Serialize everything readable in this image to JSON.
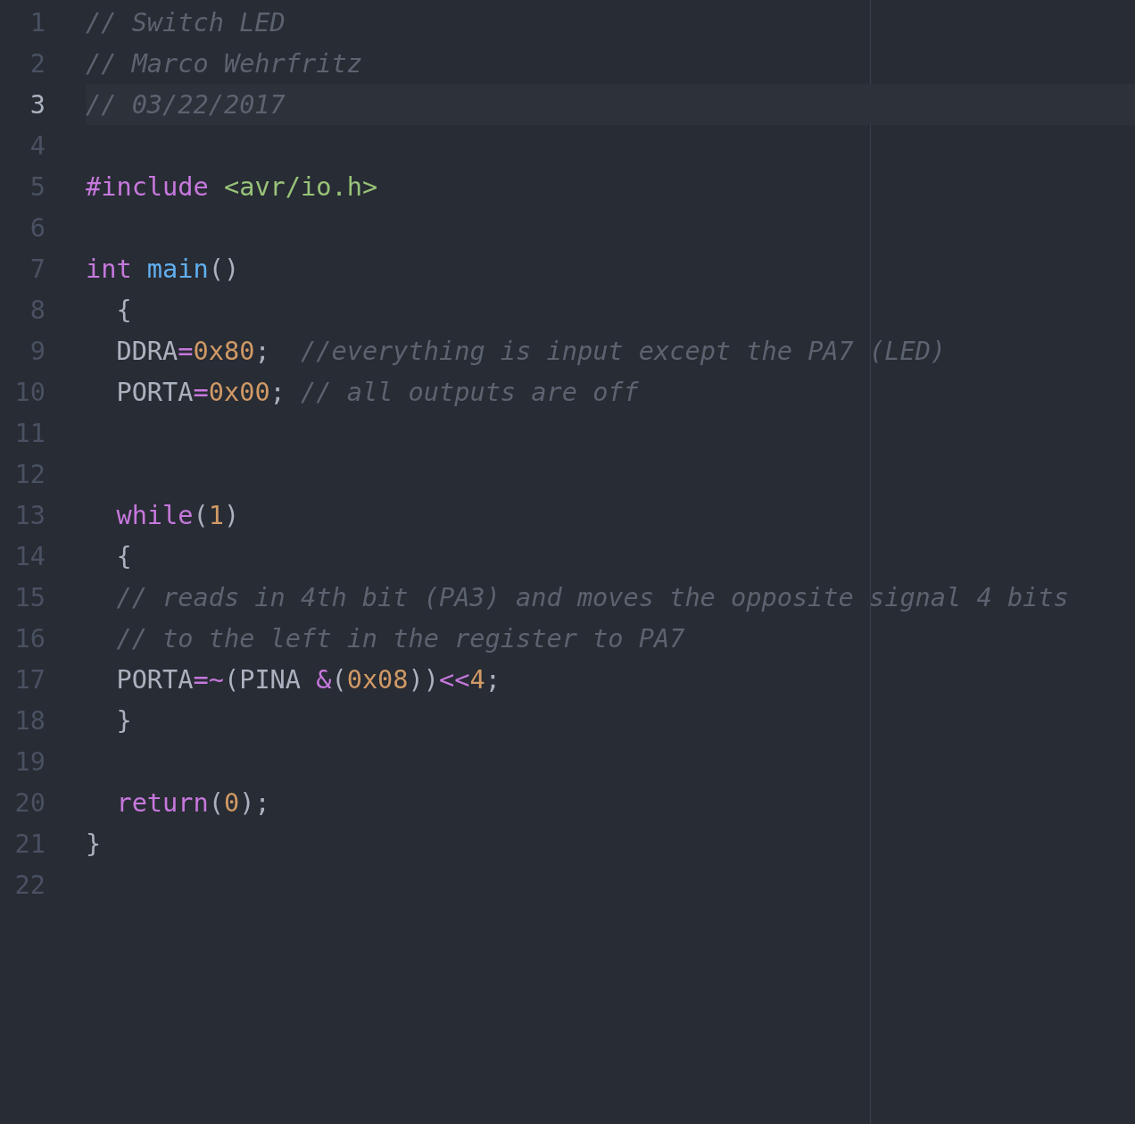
{
  "editor": {
    "lines": [
      {
        "number": "1",
        "selected": false,
        "tokens": [
          {
            "kind": "comment",
            "text": "// Switch LED"
          }
        ]
      },
      {
        "number": "2",
        "selected": false,
        "tokens": [
          {
            "kind": "comment",
            "text": "// Marco Wehrfritz"
          }
        ]
      },
      {
        "number": "3",
        "selected": true,
        "tokens": [
          {
            "kind": "comment",
            "text": "// 03/22/2017"
          }
        ]
      },
      {
        "number": "4",
        "selected": false
      },
      {
        "number": "5",
        "selected": false,
        "tokens": [
          {
            "kind": "keyword",
            "text": "#include"
          },
          {
            "kind": "string",
            "text": " <avr/io.h>"
          }
        ]
      },
      {
        "number": "6",
        "selected": false
      },
      {
        "number": "7",
        "selected": false,
        "tokens": [
          {
            "kind": "keyword",
            "text": "int"
          },
          {
            "kind": "function",
            "text": " main"
          },
          {
            "kind": "plain",
            "text": "()"
          }
        ]
      },
      {
        "number": "8",
        "selected": false,
        "tokens": [
          {
            "kind": "plain",
            "text": "  {"
          }
        ]
      },
      {
        "number": "9",
        "selected": false,
        "tokens": [
          {
            "kind": "plain",
            "text": "  DDRA"
          },
          {
            "kind": "operator",
            "text": "="
          },
          {
            "kind": "number",
            "text": "0x80"
          },
          {
            "kind": "plain",
            "text": ";  "
          },
          {
            "kind": "comment",
            "text": "//everything is input except the PA7 (LED)"
          }
        ]
      },
      {
        "number": "10",
        "selected": false,
        "tokens": [
          {
            "kind": "plain",
            "text": "  PORTA"
          },
          {
            "kind": "operator",
            "text": "="
          },
          {
            "kind": "number",
            "text": "0x00"
          },
          {
            "kind": "plain",
            "text": "; "
          },
          {
            "kind": "comment",
            "text": "// all outputs are off"
          }
        ]
      },
      {
        "number": "11",
        "selected": false
      },
      {
        "number": "12",
        "selected": false
      },
      {
        "number": "13",
        "selected": false,
        "tokens": [
          {
            "kind": "keyword",
            "text": "  while"
          },
          {
            "kind": "plain",
            "text": "("
          },
          {
            "kind": "number",
            "text": "1"
          },
          {
            "kind": "plain",
            "text": ")"
          }
        ]
      },
      {
        "number": "14",
        "selected": false,
        "tokens": [
          {
            "kind": "plain",
            "text": "  {"
          }
        ]
      },
      {
        "number": "15",
        "selected": false,
        "tokens": [
          {
            "kind": "comment",
            "text": "  // reads in 4th bit (PA3) and moves the opposite signal 4 bits"
          }
        ]
      },
      {
        "number": "16",
        "selected": false,
        "tokens": [
          {
            "kind": "comment",
            "text": "  // to the left in the register to PA7"
          }
        ]
      },
      {
        "number": "17",
        "selected": false,
        "tokens": [
          {
            "kind": "plain",
            "text": "  PORTA"
          },
          {
            "kind": "operator",
            "text": "=~"
          },
          {
            "kind": "plain",
            "text": "(PINA "
          },
          {
            "kind": "operator",
            "text": "&"
          },
          {
            "kind": "plain",
            "text": "("
          },
          {
            "kind": "number",
            "text": "0x08"
          },
          {
            "kind": "plain",
            "text": "))"
          },
          {
            "kind": "operator",
            "text": "<<"
          },
          {
            "kind": "number",
            "text": "4"
          },
          {
            "kind": "plain",
            "text": ";"
          }
        ]
      },
      {
        "number": "18",
        "selected": false,
        "tokens": [
          {
            "kind": "plain",
            "text": "  }"
          }
        ]
      },
      {
        "number": "19",
        "selected": false
      },
      {
        "number": "20",
        "selected": false,
        "tokens": [
          {
            "kind": "keyword",
            "text": "  return"
          },
          {
            "kind": "plain",
            "text": "("
          },
          {
            "kind": "number",
            "text": "0"
          },
          {
            "kind": "plain",
            "text": ");"
          }
        ]
      },
      {
        "number": "21",
        "selected": false,
        "tokens": [
          {
            "kind": "plain",
            "text": "}"
          }
        ]
      },
      {
        "number": "22",
        "selected": false
      }
    ]
  }
}
